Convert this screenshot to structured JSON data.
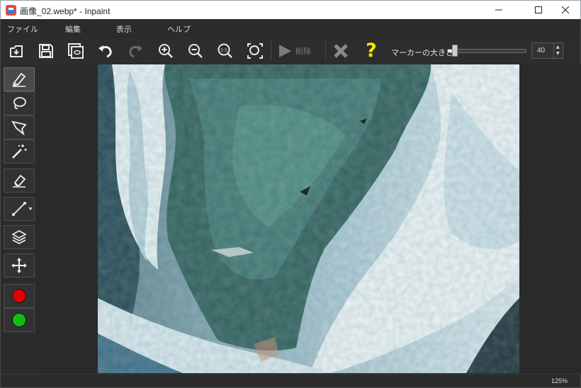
{
  "window": {
    "title": "画像_02.webp* - Inpaint",
    "minimize_icon": "minimize-icon",
    "maximize_icon": "maximize-icon",
    "close_icon": "close-icon"
  },
  "menu": {
    "items": [
      "ファイル",
      "編集",
      "表示",
      "ヘルプ"
    ]
  },
  "toolbar": {
    "icons": [
      "open-icon",
      "save-icon",
      "save-as-icon",
      "undo-icon",
      "redo-icon",
      "zoom-in-icon",
      "zoom-out-icon",
      "actual-size-icon",
      "fit-to-window-icon",
      "play-icon",
      "cancel-icon",
      "help-icon"
    ],
    "delete_label": "削除",
    "help_label": "?",
    "marker_size_label": "マーカーの大きさ",
    "marker_size_value": "40",
    "marker_size_fraction": 0.06
  },
  "tools": {
    "items": [
      "marker-icon",
      "lasso-icon",
      "polygonal-lasso-icon",
      "magic-wand-icon",
      "eraser-icon",
      "guide-line-icon",
      "layers-icon",
      "move-icon"
    ],
    "colors": {
      "primary": "#e00000",
      "secondary": "#10c010"
    }
  },
  "canvas": {
    "image_subject": "ocean waves crashing on rocks"
  },
  "status": {
    "zoom": "125%"
  },
  "colors": {
    "background": "#2b2b2b",
    "help_accent": "#f2e600",
    "disabled_text": "#7c7c7c"
  }
}
